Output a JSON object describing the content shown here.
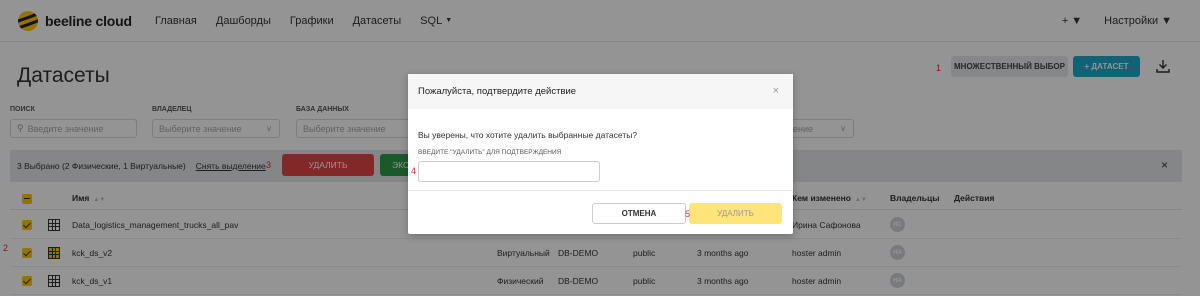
{
  "app": {
    "logo_text": "beeline cloud"
  },
  "nav": {
    "items": [
      "Главная",
      "Дашборды",
      "Графики",
      "Датасеты",
      "SQL"
    ]
  },
  "topright": {
    "plus": "+",
    "settings": "Настройки"
  },
  "page": {
    "title": "Датасеты"
  },
  "actions": {
    "multi_select": "МНОЖЕСТВЕННЫЙ ВЫБОР",
    "add_dataset": "+ ДАТАСЕТ"
  },
  "annotations": {
    "a1": "1",
    "a2": "2",
    "a3": "3",
    "a4": "4",
    "a5": "5"
  },
  "filters": {
    "search": {
      "label": "ПОИСК",
      "placeholder": "Введите значение"
    },
    "owner": {
      "label": "ВЛАДЕЛЕЦ",
      "placeholder": "Выберите значение"
    },
    "database": {
      "label": "БАЗА ДАННЫХ",
      "placeholder": "Выберите значение"
    },
    "fourth": {
      "placeholder": "ение"
    }
  },
  "bulk": {
    "selected_text": "3 Выбрано (2 Физические, 1 Виртуальные)",
    "clear": "Снять выделение",
    "delete": "УДАЛИТЬ",
    "export": "ЭКСПО",
    "close": "×"
  },
  "table": {
    "headers": {
      "name": "Имя",
      "changed_by": "Кем изменено",
      "owners": "Владельцы",
      "actions": "Действия"
    },
    "rows": [
      {
        "name": "Data_logistics_management_trucks_all_pav",
        "type": "",
        "db": "",
        "schema": "",
        "modified": "",
        "changed_by": "Ирина Сафонова",
        "owner_initials": "ИС"
      },
      {
        "name": "kck_ds_v2",
        "type": "Виртуальный",
        "db": "DB-DEMO",
        "schema": "public",
        "modified": "3 months ago",
        "changed_by": "hoster admin",
        "owner_initials": "HA"
      },
      {
        "name": "kck_ds_v1",
        "type": "Физический",
        "db": "DB-DEMO",
        "schema": "public",
        "modified": "3 months ago",
        "changed_by": "hoster admin",
        "owner_initials": "HA"
      }
    ]
  },
  "modal": {
    "title": "Пожалуйста, подтвердите действие",
    "close": "×",
    "question": "Вы уверены, что хотите удалить выбранные датасеты?",
    "input_label": "ВВЕДИТЕ \"УДАЛИТЬ\" ДЛЯ ПОДТВЕРЖДЕНИЯ",
    "input_value": "",
    "cancel": "ОТМЕНА",
    "confirm": "УДАЛИТЬ"
  },
  "colors": {
    "accent": "#20a7c9",
    "brand": "#ffc800",
    "danger": "#e04545",
    "success": "#2e9c48"
  }
}
